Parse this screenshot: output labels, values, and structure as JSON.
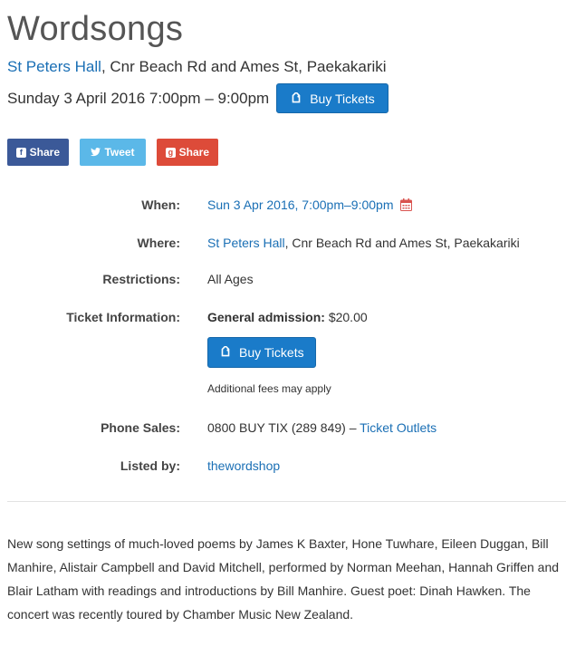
{
  "event": {
    "title": "Wordsongs",
    "venue_name": "St Peters Hall",
    "venue_address": ", Cnr Beach Rd and Ames St, Paekakariki",
    "datetime": "Sunday 3 April 2016 7:00pm – 9:00pm",
    "buy_tickets_label": "Buy Tickets"
  },
  "share": {
    "facebook_label": "Share",
    "twitter_label": "Tweet",
    "google_label": "Share"
  },
  "details": {
    "when_label": "When:",
    "when_value": "Sun 3 Apr 2016, 7:00pm–9:00pm",
    "where_label": "Where:",
    "where_venue": "St Peters Hall",
    "where_address": ", Cnr Beach Rd and Ames St, Paekakariki",
    "restrictions_label": "Restrictions:",
    "restrictions_value": "All Ages",
    "ticket_info_label": "Ticket Information:",
    "ticket_type": "General admission:",
    "ticket_price": " $20.00",
    "buy_tickets_label": "Buy Tickets",
    "fees_note": "Additional fees may apply",
    "phone_label": "Phone Sales:",
    "phone_value": "0800 BUY TIX (289 849) – ",
    "ticket_outlets_link": "Ticket Outlets",
    "listed_by_label": "Listed by:",
    "listed_by_value": "thewordshop"
  },
  "description": "New song settings of much-loved poems by James K Baxter, Hone Tuwhare, Eileen Duggan, Bill Manhire, Alistair Campbell and David Mitchell, performed by Norman Meehan, Hannah Griffen and Blair Latham with readings and introductions by Bill Manhire. Guest poet: Dinah Hawken. The concert was recently toured by Chamber Music New Zealand.",
  "colors": {
    "link": "#1a6fb5",
    "button": "#1a7bc9",
    "facebook": "#3b5998",
    "twitter": "#5bb8e8",
    "google": "#dd4b39",
    "calendar_icon": "#d9534f"
  },
  "icons": [
    "ticket-icon",
    "facebook-icon",
    "twitter-icon",
    "google-plus-icon",
    "calendar-icon"
  ]
}
